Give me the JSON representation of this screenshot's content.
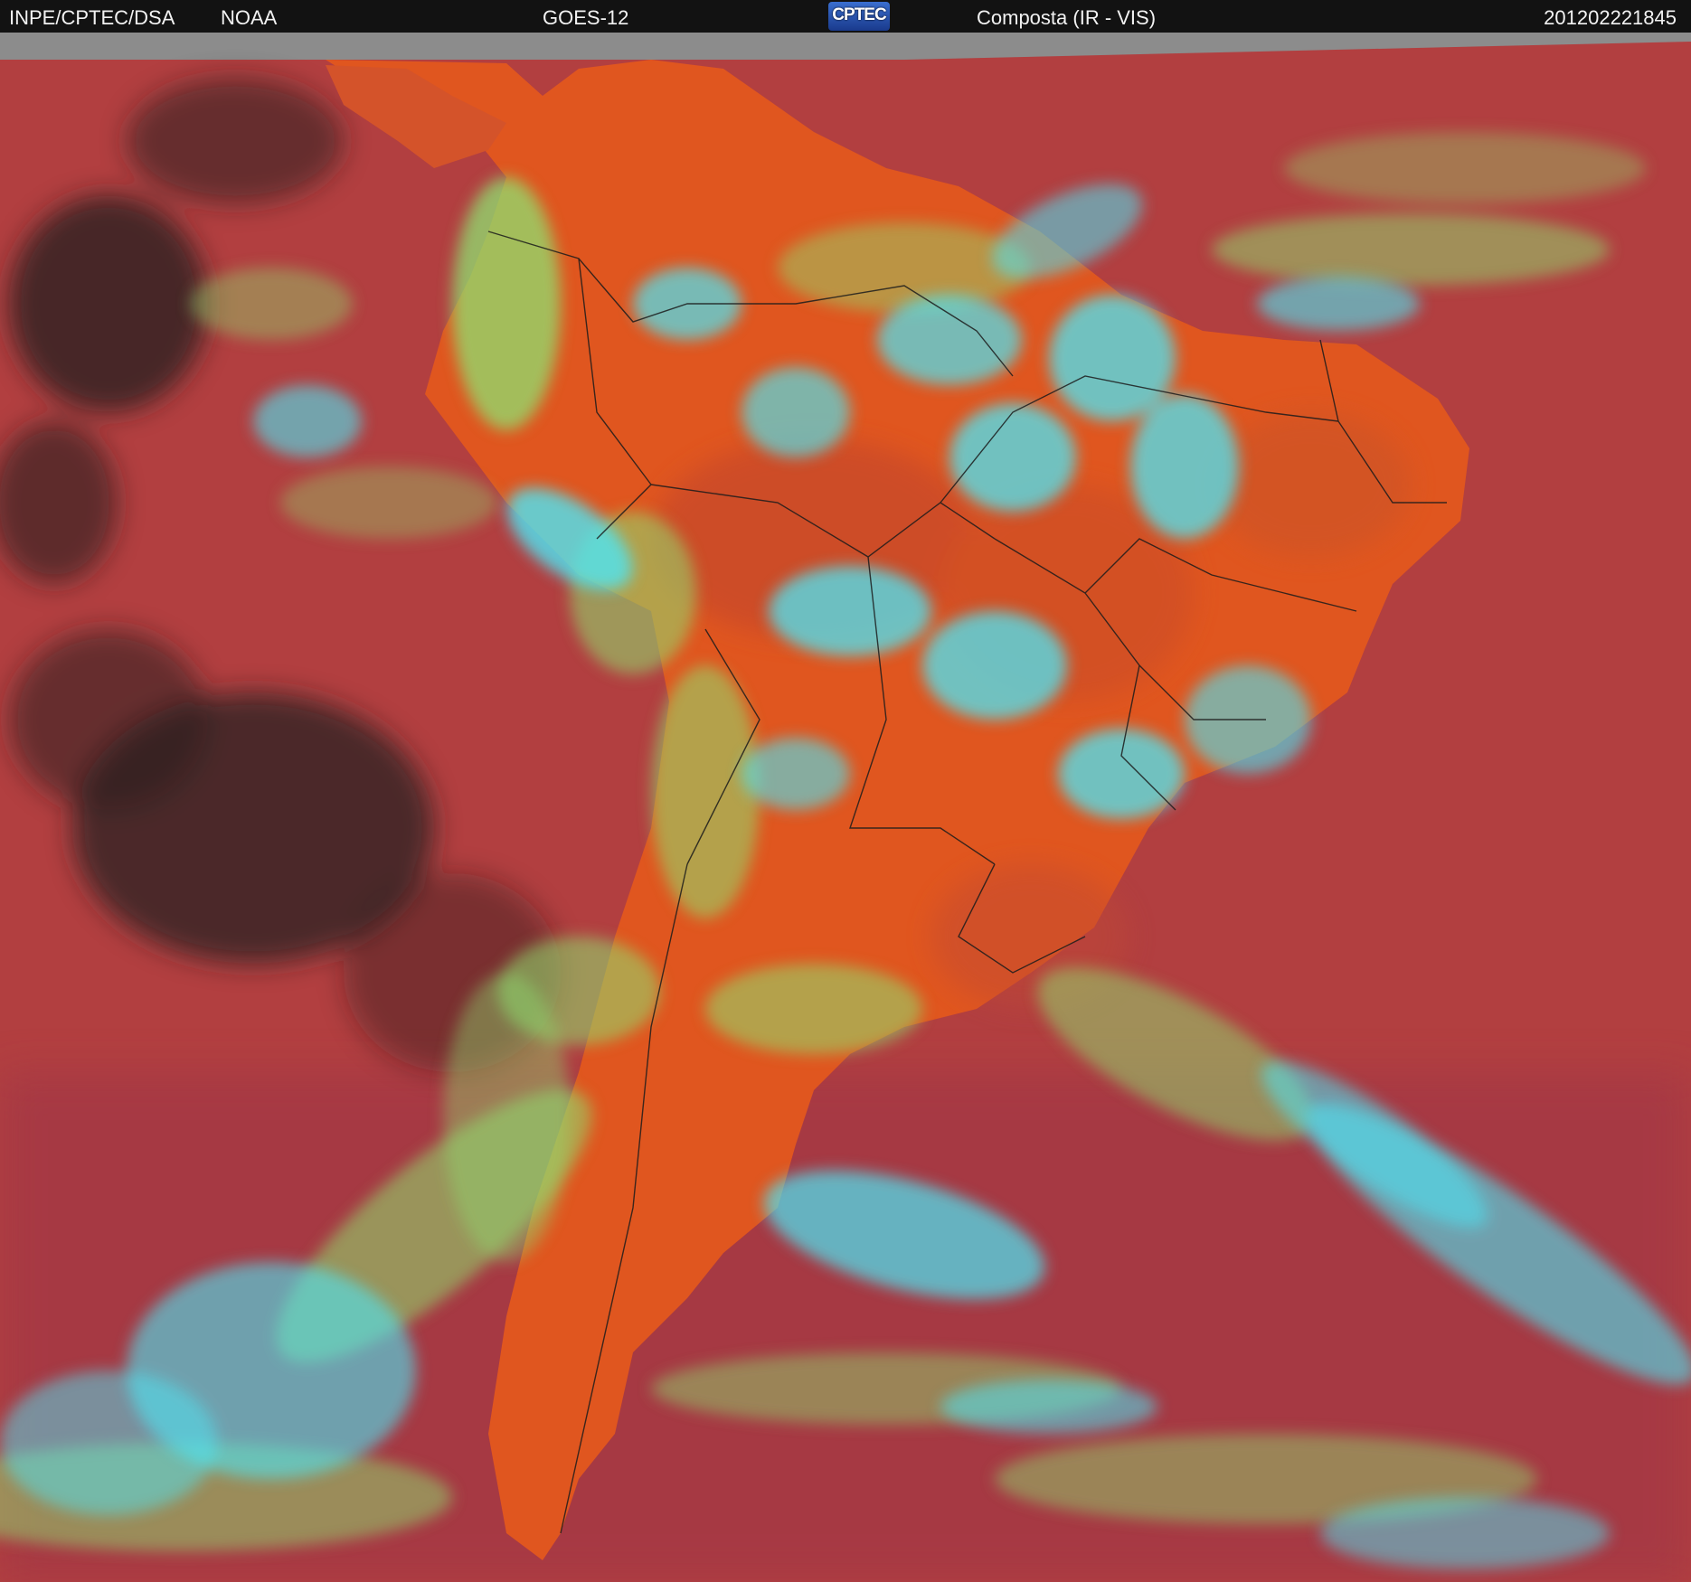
{
  "header": {
    "source": "INPE/CPTEC/DSA",
    "agency": "NOAA",
    "satellite": "GOES-12",
    "logo_text": "CPTEC",
    "product": "Composta (IR - VIS)",
    "timestamp": "201202221845"
  },
  "image": {
    "subject": "satellite-composite-south-america",
    "colors": {
      "ocean": "#b03e3e",
      "land": "#e35a1e",
      "cold-cloud": "#4de6f5",
      "low-cloud": "#8fe070",
      "clear-sky": "#2a1f1f",
      "no-data": "#8a8a8a"
    }
  }
}
